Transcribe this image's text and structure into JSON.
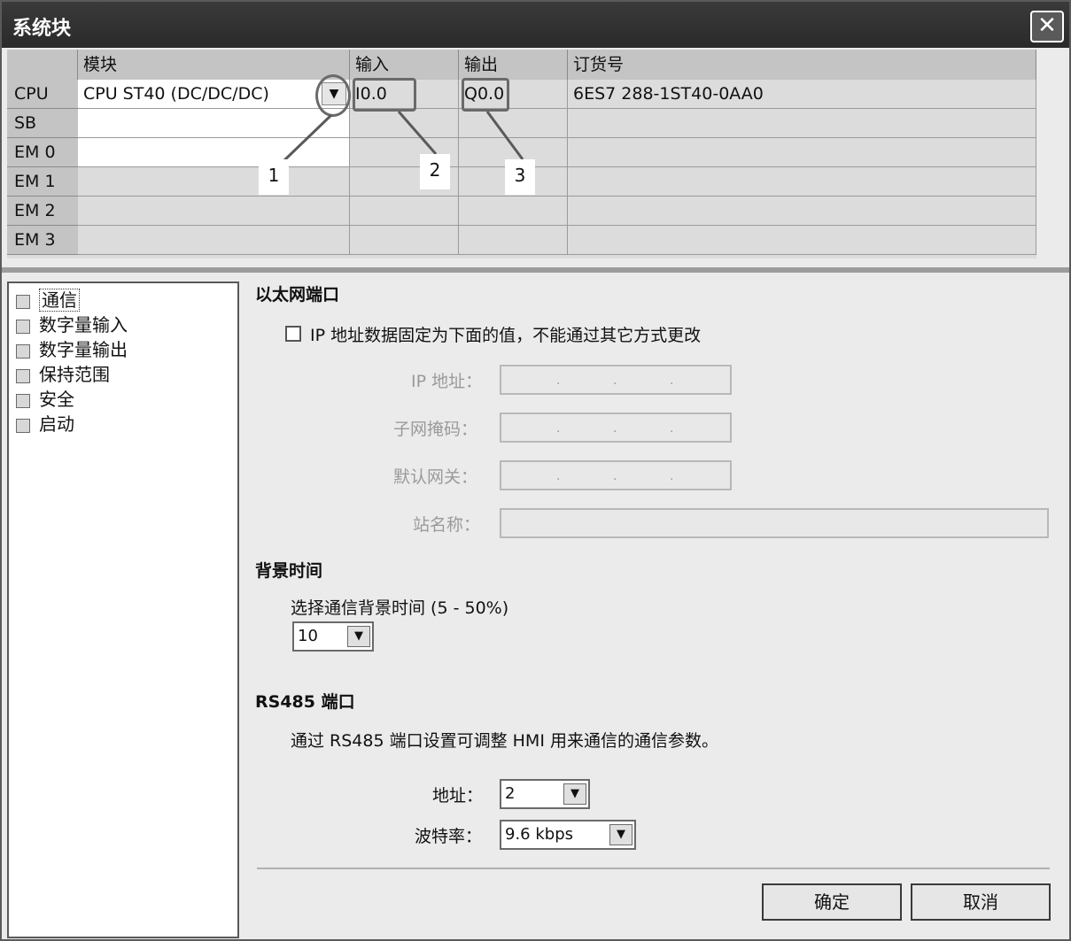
{
  "window": {
    "title": "系统块",
    "close_glyph": "✕"
  },
  "grid": {
    "headers": [
      "模块",
      "输入",
      "输出",
      "订货号"
    ],
    "rows": [
      {
        "slot": "CPU",
        "module": "CPU ST40 (DC/DC/DC)",
        "input": "I0.0",
        "output": "Q0.0",
        "order_no": "6ES7 288-1ST40-0AA0"
      },
      {
        "slot": "SB",
        "module": "",
        "input": "",
        "output": "",
        "order_no": ""
      },
      {
        "slot": "EM 0",
        "module": "",
        "input": "",
        "output": "",
        "order_no": ""
      },
      {
        "slot": "EM 1",
        "module": "",
        "input": "",
        "output": "",
        "order_no": ""
      },
      {
        "slot": "EM 2",
        "module": "",
        "input": "",
        "output": "",
        "order_no": ""
      },
      {
        "slot": "EM 3",
        "module": "",
        "input": "",
        "output": "",
        "order_no": ""
      }
    ],
    "annotations": [
      "1",
      "2",
      "3"
    ]
  },
  "tree": {
    "items": [
      "通信",
      "数字量输入",
      "数字量输出",
      "保持范围",
      "安全",
      "启动"
    ],
    "selected": "通信"
  },
  "ethernet": {
    "title": "以太网端口",
    "fixed_ip_label": "IP 地址数据固定为下面的值，不能通过其它方式更改",
    "ip_label": "IP 地址：",
    "mask_label": "子网掩码：",
    "gateway_label": "默认网关：",
    "station_label": "站名称：",
    "dot": "."
  },
  "background": {
    "title": "背景时间",
    "desc": "选择通信背景时间 (5 - 50%)",
    "value": "10"
  },
  "rs485": {
    "title": "RS485 端口",
    "desc": "通过 RS485 端口设置可调整 HMI 用来通信的通信参数。",
    "address_label": "地址：",
    "address_value": "2",
    "baud_label": "波特率：",
    "baud_value": "9.6 kbps"
  },
  "buttons": {
    "ok": "确定",
    "cancel": "取消"
  },
  "icons": {
    "dropdown": "▼"
  }
}
